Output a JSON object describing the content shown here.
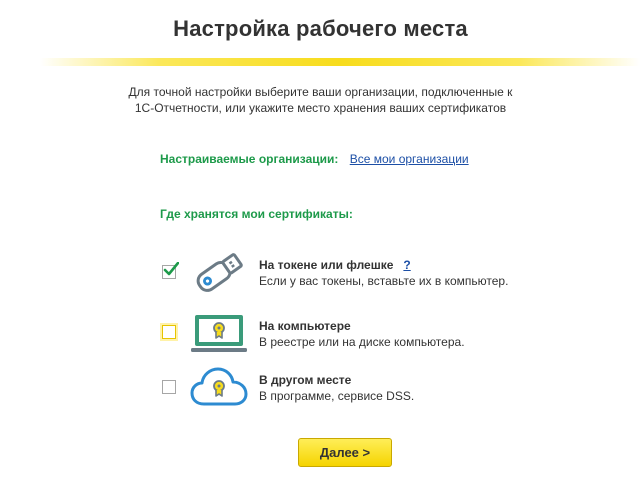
{
  "page": {
    "title": "Настройка рабочего места",
    "intro_line1": "Для точной настройки выберите ваши организации, подключенные к",
    "intro_line2": "1С-Отчетности, или укажите место хранения ваших сертификатов"
  },
  "organizations": {
    "label": "Настраиваемые организации:",
    "link": "Все мои организации"
  },
  "certificates": {
    "label": "Где хранятся мои сертификаты:",
    "options": [
      {
        "title": "На токене или флешке",
        "help": "?",
        "description": "Если у вас токены, вставьте их в компьютер.",
        "checked": true,
        "icon": "usb-flash-icon"
      },
      {
        "title": "На компьютере",
        "description": "В реестре или на диске компьютера.",
        "checked": false,
        "icon": "laptop-certificate-icon"
      },
      {
        "title": "В другом месте",
        "description": "В программе, сервисе DSS.",
        "checked": false,
        "icon": "cloud-certificate-icon"
      }
    ]
  },
  "actions": {
    "next_label": "Далее >"
  },
  "colors": {
    "accent_yellow": "#f5d400",
    "green_label": "#1d9a4a",
    "link_blue": "#1c4fa6",
    "icon_gray": "#6c7b86",
    "icon_blue": "#2d8bd1",
    "icon_green": "#3a9b7a"
  }
}
